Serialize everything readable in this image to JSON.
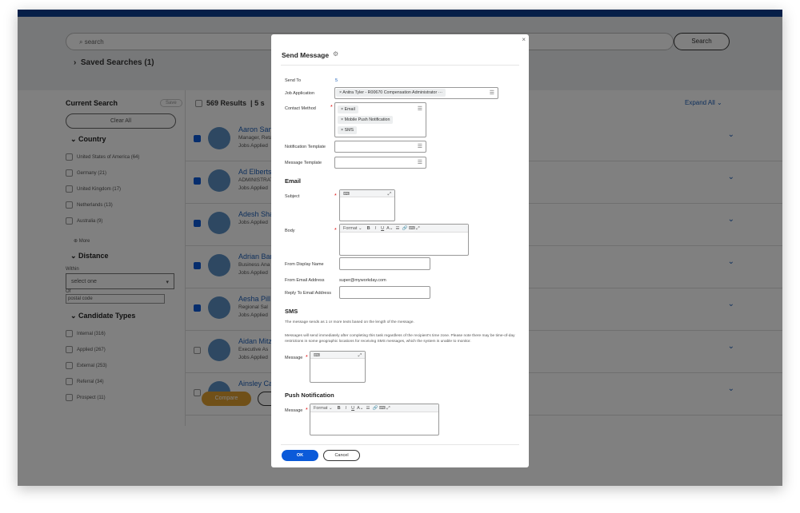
{
  "search": {
    "placeholder": "search",
    "button": "Search",
    "saved": "Saved Searches (1)"
  },
  "sidebar": {
    "title": "Current Search",
    "save": "Save",
    "clear": "Clear All",
    "country": {
      "title": "Country",
      "items": [
        "United States of America (64)",
        "Germany (21)",
        "United Kingdom (17)",
        "Netherlands (13)",
        "Australia (9)"
      ],
      "more": "More"
    },
    "distance": {
      "title": "Distance",
      "within": "Within",
      "select": "select one",
      "of": "Of",
      "postal": "postal code"
    },
    "types": {
      "title": "Candidate Types",
      "items": [
        "Internal (316)",
        "Applied (267)",
        "External (253)",
        "Referral (34)",
        "Prospect (11)"
      ]
    }
  },
  "results": {
    "count": "569 Results",
    "selected": "5 s",
    "expand": "Expand All",
    "compare": "Compare",
    "rows": [
      {
        "name": "Aaron Sanc",
        "l1": "Manager, Reta",
        "l2": "Jobs Applied",
        "checked": true
      },
      {
        "name": "Ad Elbertse",
        "l1": "ADMINISTRAT",
        "l2": "Jobs Applied",
        "checked": true
      },
      {
        "name": "Adesh Shal",
        "l1": "Jobs Applied",
        "l2": "",
        "checked": true
      },
      {
        "name": "Adrian Ban",
        "l1": "Business Ana",
        "l2": "Jobs Applied",
        "checked": true
      },
      {
        "name": "Aesha Pill",
        "l1": "Regional Sal",
        "l2": "Jobs Applied",
        "checked": true
      },
      {
        "name": "Aidan Mitz",
        "l1": "Executive As",
        "l2": "Jobs Applied",
        "checked": false
      },
      {
        "name": "Ainsley Ca",
        "l1": "",
        "l2": "",
        "checked": false
      }
    ]
  },
  "modal": {
    "title": "Send Message",
    "close": "×",
    "send_to_label": "Send To",
    "send_to": "5",
    "job_label": "Job Application",
    "job_value": "Anitra Tyler - R00670 Compensation Administrator",
    "contact_label": "Contact Method",
    "contact": [
      "Email",
      "Mobile Push Notification",
      "SMS"
    ],
    "notif_label": "Notification Template",
    "msgtpl_label": "Message Template",
    "email_title": "Email",
    "subject_label": "Subject",
    "body_label": "Body",
    "format": "Format",
    "from_name_label": "From Display Name",
    "from_email_label": "From Email Address",
    "from_email": "super@myworkday.com",
    "reply_label": "Reply To Email Address",
    "sms_title": "SMS",
    "sms_note1": "The message sends as 1 or more texts based on the length of the message.",
    "sms_note2": "Messages will send immediately after completing this task regardless of the recipient's time zone. Please note there may be time-of-day restrictions in some geographic locations for receiving SMS messages, which the system is unable to monitor.",
    "message_label": "Message",
    "push_title": "Push Notification",
    "ok": "OK",
    "cancel": "Cancel"
  },
  "colors": {
    "accent": "#0b5ad9",
    "topbar": "#0b3d91",
    "compare": "#e0a030"
  }
}
